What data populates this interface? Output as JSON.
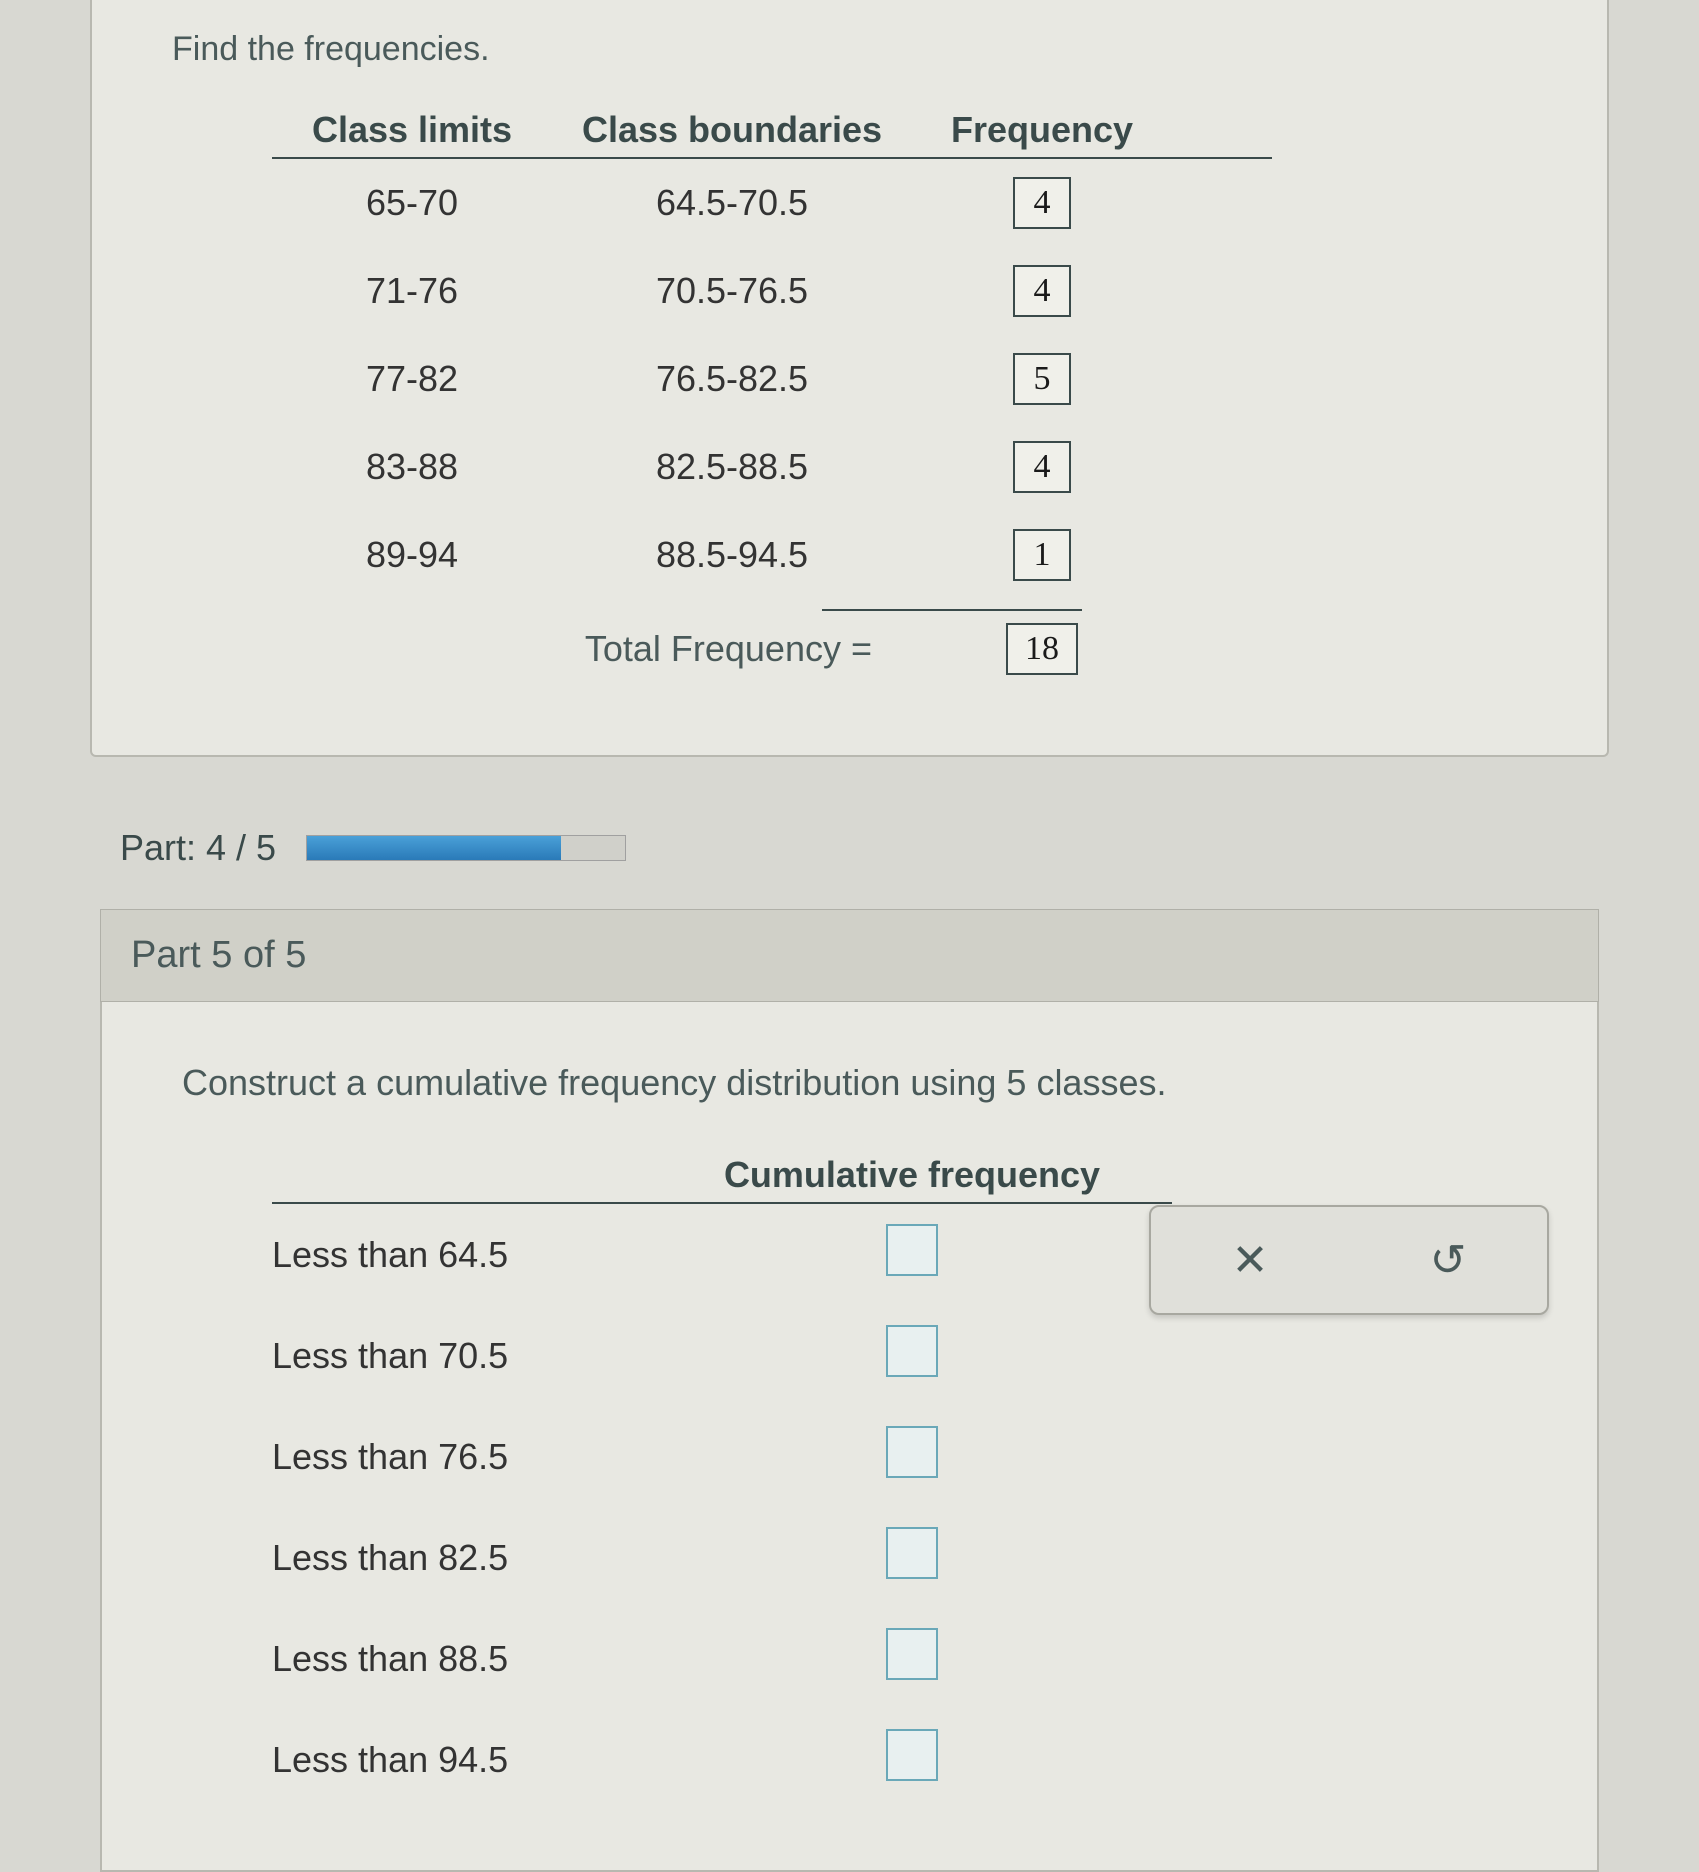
{
  "top": {
    "instruction": "Find the frequencies.",
    "headers": {
      "limits": "Class limits",
      "boundaries": "Class boundaries",
      "frequency": "Frequency"
    },
    "rows": [
      {
        "limits": "65-70",
        "boundaries": "64.5-70.5",
        "freq": "4"
      },
      {
        "limits": "71-76",
        "boundaries": "70.5-76.5",
        "freq": "4"
      },
      {
        "limits": "77-82",
        "boundaries": "76.5-82.5",
        "freq": "5"
      },
      {
        "limits": "83-88",
        "boundaries": "82.5-88.5",
        "freq": "4"
      },
      {
        "limits": "89-94",
        "boundaries": "88.5-94.5",
        "freq": "1"
      }
    ],
    "total_label": "Total Frequency  =",
    "total_value": "18"
  },
  "progress": {
    "label": "Part: 4 / 5"
  },
  "part5": {
    "header": "Part 5 of 5",
    "instruction": "Construct a cumulative frequency distribution using 5 classes.",
    "col_header": "Cumulative frequency",
    "rows": [
      "Less than 64.5",
      "Less than 70.5",
      "Less than 76.5",
      "Less than 82.5",
      "Less than 88.5",
      "Less than 94.5"
    ]
  },
  "actions": {
    "close": "✕",
    "reset": "↺"
  }
}
